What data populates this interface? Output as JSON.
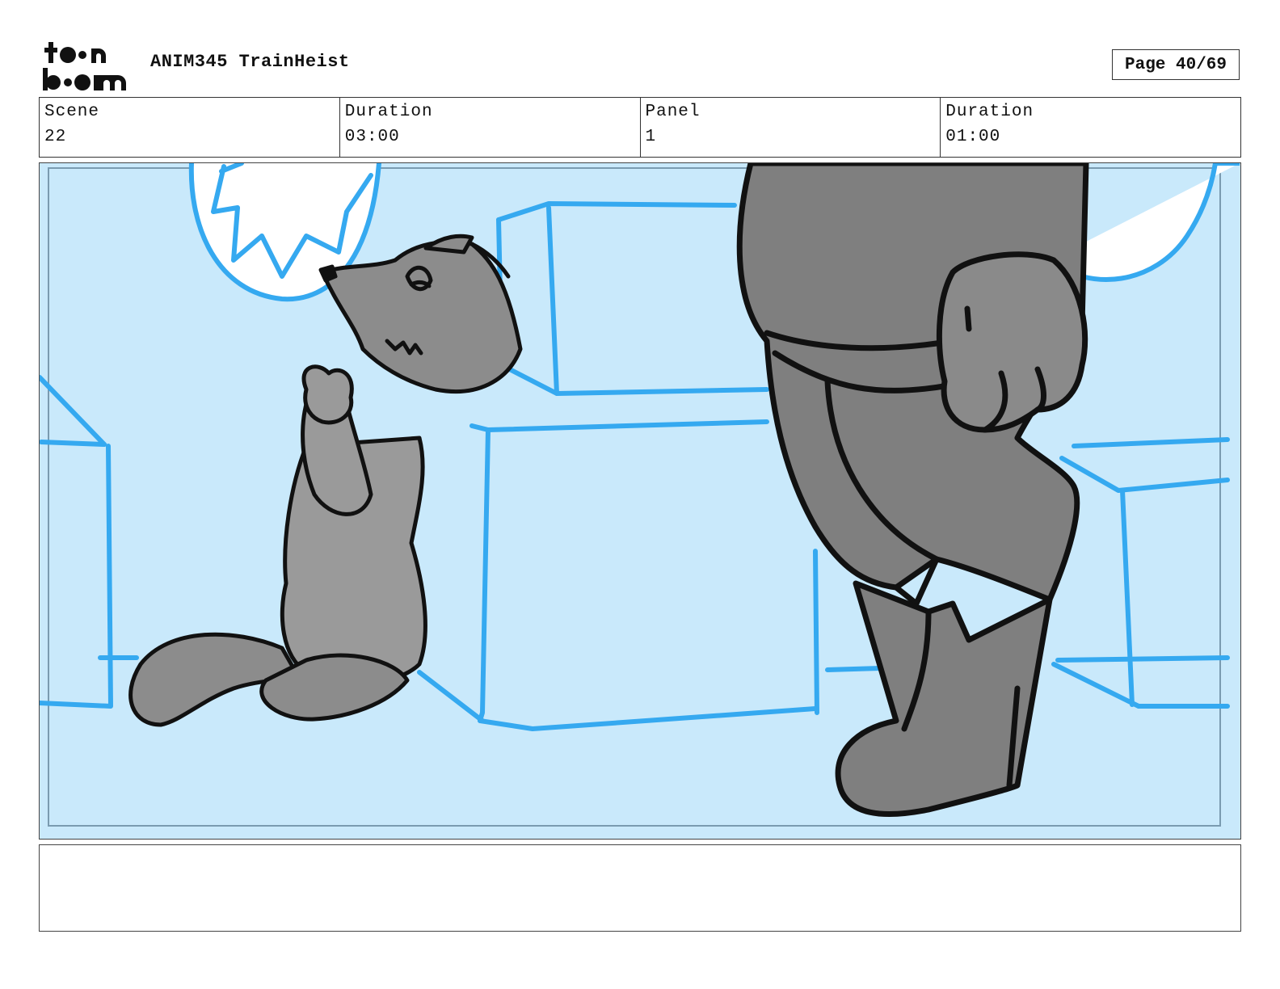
{
  "header": {
    "logo_text": "toon boom",
    "project_title": "ANIM345 TrainHeist",
    "page_label": "Page 40/69"
  },
  "info": [
    {
      "label": "Scene",
      "value": "22"
    },
    {
      "label": "Duration",
      "value": "03:00"
    },
    {
      "label": "Panel",
      "value": "1"
    },
    {
      "label": "Duration",
      "value": "01:00"
    }
  ],
  "notes": {
    "text": ""
  },
  "colors": {
    "background": "#c9e9fb",
    "line_blue": "#35a9f0",
    "character_gray": "#8a8a8a",
    "outline": "#111111"
  }
}
